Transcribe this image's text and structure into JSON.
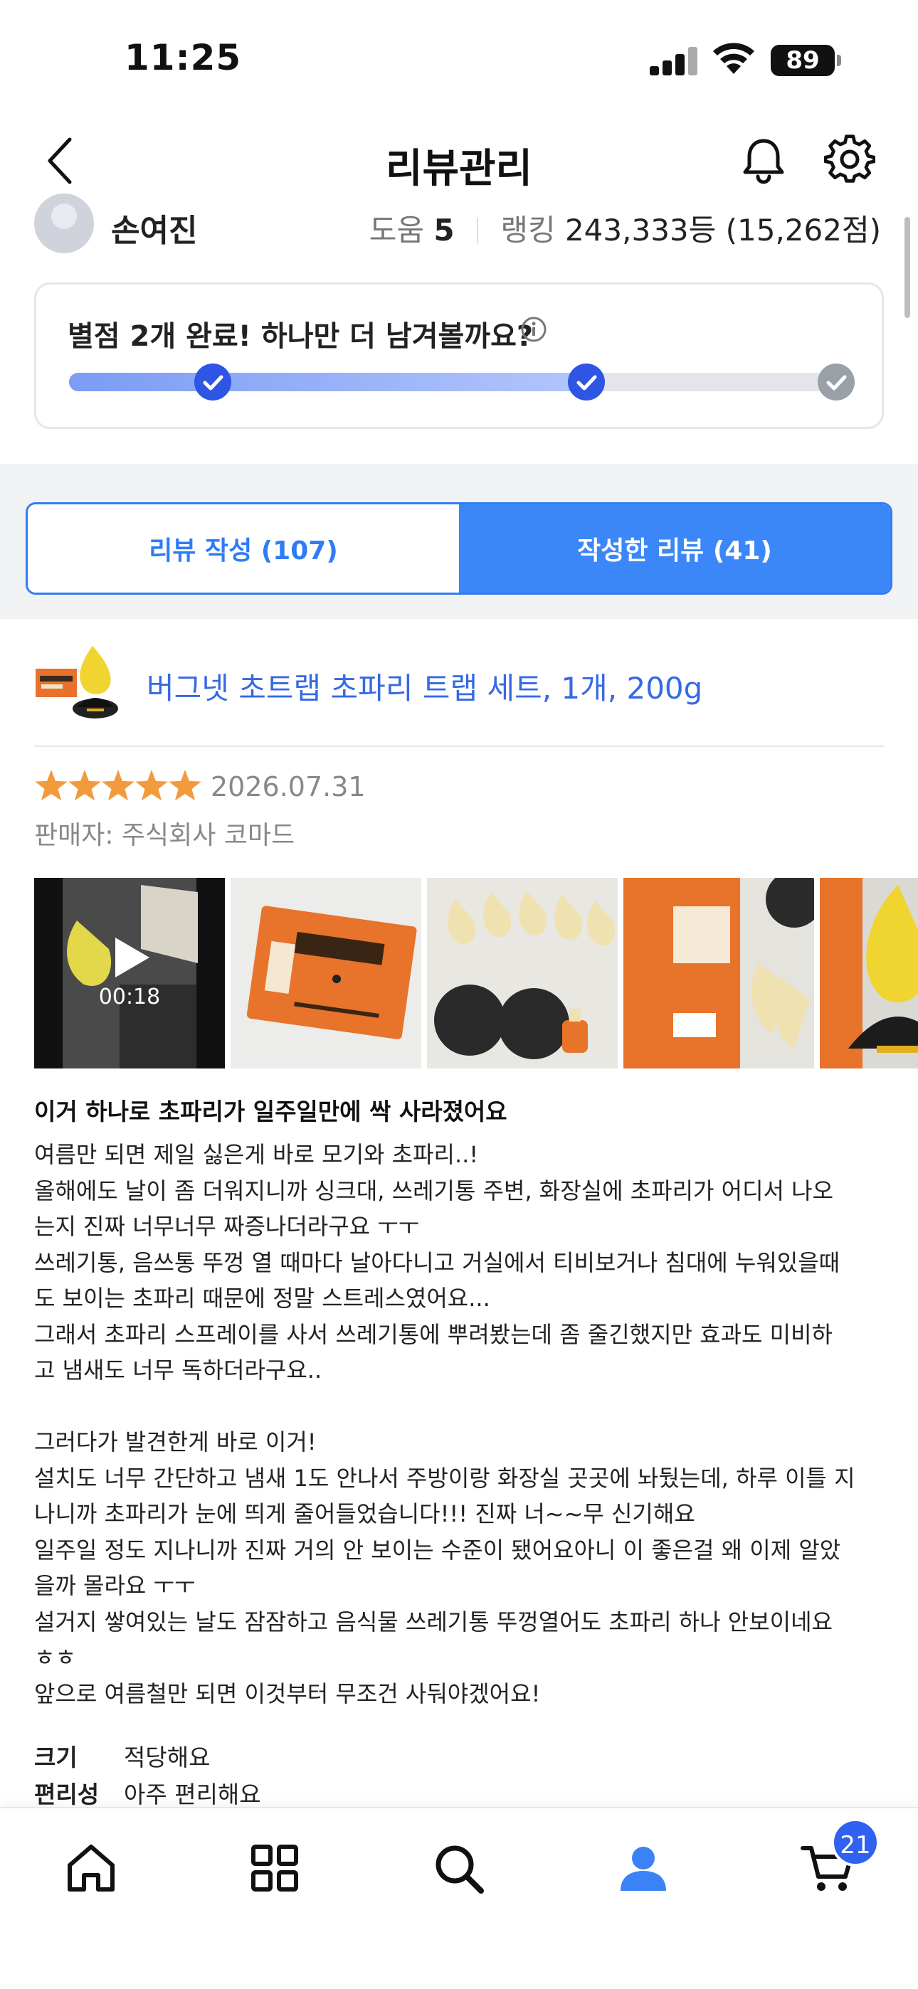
{
  "status_bar": {
    "time": "11:25",
    "battery": "89"
  },
  "header": {
    "title": "리뷰관리"
  },
  "profile": {
    "name": "손여진",
    "help_label": "도움",
    "help_count": "5",
    "ranking_label": "랭킹",
    "ranking_value": "243,333등 (15,262점)"
  },
  "progress": {
    "text": "별점 2개 완료! 하나만 더 남겨볼까요?",
    "completed": 2,
    "total": 3
  },
  "tabs": [
    {
      "label": "리뷰 작성 (107)"
    },
    {
      "label": "작성한 리뷰 (41)"
    }
  ],
  "product": {
    "name": "버그넷 초트랩 초파리 트랩 세트, 1개, 200g"
  },
  "review": {
    "rating": 5,
    "date": "2026.07.31",
    "seller": "판매자: 주식회사 코마드",
    "video_duration": "00:18",
    "title": "이거 하나로 초파리가 일주일만에 싹 사라졌어요",
    "body": "여름만 되면 제일 싫은게 바로 모기와 초파리..!\n올해에도 날이 좀 더워지니까 싱크대, 쓰레기통 주변, 화장실에 초파리가 어디서 나오\n는지 진짜 너무너무 짜증나더라구요 ㅜㅜ\n쓰레기통, 음쓰통 뚜껑 열 때마다 날아다니고 거실에서 티비보거나 침대에 누워있을때\n도 보이는 초파리 때문에 정말 스트레스였어요...\n그래서 초파리 스프레이를 사서 쓰레기통에 뿌려봤는데 좀 줄긴했지만 효과도 미비하\n고 냄새도 너무 독하더라구요..\n\n그러다가 발견한게 바로 이거!\n설치도 너무 간단하고 냄새 1도 안나서 주방이랑 화장실 곳곳에 놔뒀는데, 하루 이틀 지\n나니까 초파리가 눈에 띄게 줄어들었습니다!!! 진짜 너~~무 신기해요\n일주일 정도 지나니까 진짜 거의 안 보이는 수준이 됐어요아니 이 좋은걸 왜 이제 알았\n을까 몰라요 ㅜㅜ\n설거지 쌓여있는 날도 잠잠하고 음식물 쓰레기통 뚜껑열어도 초파리 하나 안보이네요\nㅎㅎ\n앞으로 여름철만 되면 이것부터 무조건 사둬야겠어요!",
    "attributes": [
      {
        "key": "크기",
        "value": "적당해요"
      },
      {
        "key": "편리성",
        "value": "아주 편리해요"
      }
    ]
  },
  "bottom_nav": {
    "items": [
      "home-icon",
      "category-icon",
      "search-icon",
      "mypage-icon",
      "cart-icon"
    ],
    "cart_count": "21"
  },
  "colors": {
    "accent": "#3b87f7",
    "star": "#f39a3c",
    "link": "#3569e6"
  }
}
